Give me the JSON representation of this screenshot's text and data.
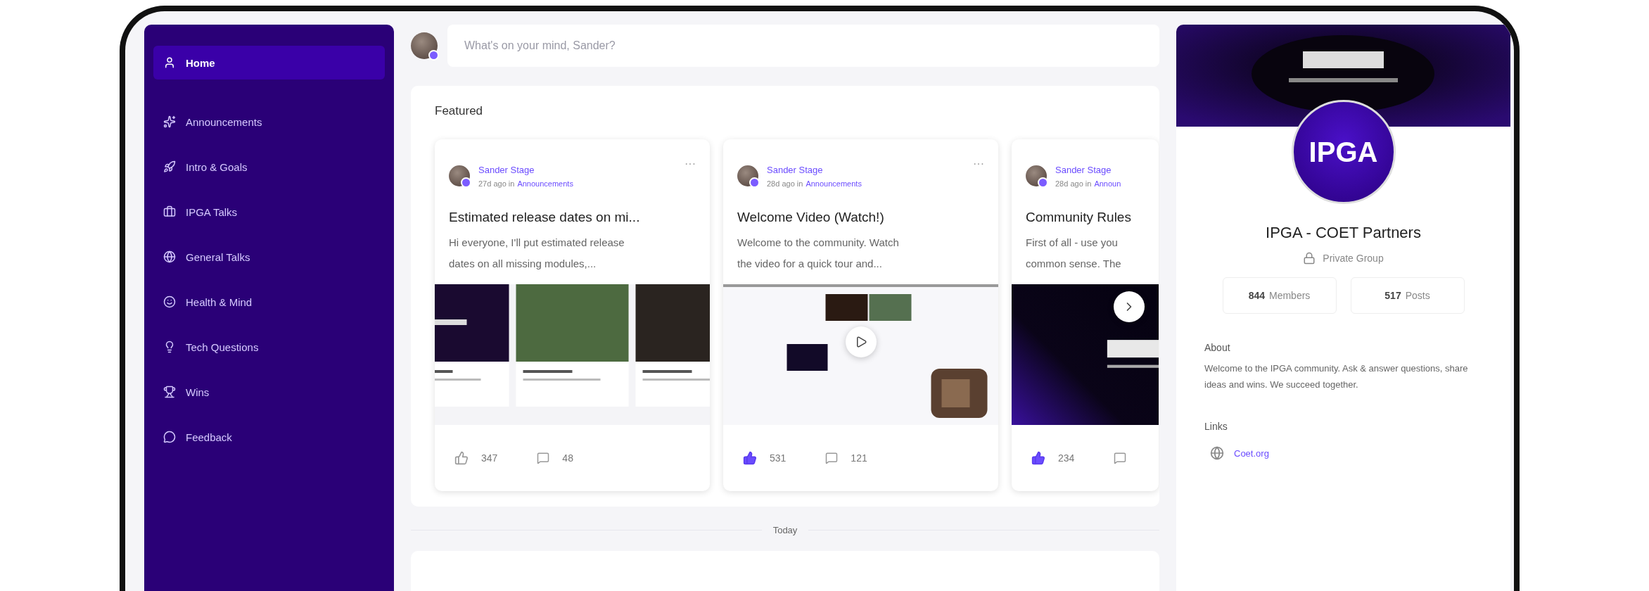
{
  "sidebar": {
    "items": [
      {
        "label": "Home",
        "selected": true
      },
      {
        "label": "Announcements",
        "selected": false
      },
      {
        "label": "Intro & Goals",
        "selected": false
      },
      {
        "label": "IPGA Talks",
        "selected": false
      },
      {
        "label": "General Talks",
        "selected": false
      },
      {
        "label": "Health & Mind",
        "selected": false
      },
      {
        "label": "Tech Questions",
        "selected": false
      },
      {
        "label": "Wins",
        "selected": false
      },
      {
        "label": "Feedback",
        "selected": false
      }
    ]
  },
  "composer": {
    "placeholder": "What's on your mind, Sander?"
  },
  "featured": {
    "title": "Featured",
    "posts": [
      {
        "author": "Sander Stage",
        "time": "27d ago in",
        "category": "Announcements",
        "menu": "···",
        "title": "Estimated release dates on mi...",
        "body_lines": [
          "Hi everyone, I'll put estimated release",
          "dates on all missing modules,..."
        ],
        "media": {
          "kind": "gallery"
        },
        "liked": false,
        "likes": "347",
        "comments": "48"
      },
      {
        "author": "Sander Stage",
        "time": "28d ago in",
        "category": "Announcements",
        "menu": "···",
        "title": "Welcome Video (Watch!)",
        "body_lines": [
          "Welcome to the community. Watch",
          "the video for a quick tour and..."
        ],
        "media": {
          "kind": "video-light"
        },
        "liked": true,
        "likes": "531",
        "comments": "121"
      },
      {
        "author": "Sander Stage",
        "time": "28d ago in",
        "category": "Announ",
        "title": "Community Rules",
        "body_lines": [
          "First of all - use you",
          "common sense. The"
        ],
        "media": {
          "kind": "video-dark"
        },
        "liked": true,
        "likes": "234"
      }
    ]
  },
  "divider": "Today",
  "group": {
    "logo": "IPGA",
    "name": "IPGA - COET Partners",
    "privacy": "Private Group",
    "stats": [
      {
        "value": "844",
        "label": "Members"
      },
      {
        "value": "517",
        "label": "Posts"
      }
    ],
    "about_title": "About",
    "about": "Welcome to the IPGA community. Ask & answer questions, share ideas and wins. We succeed together.",
    "links_title": "Links",
    "links": [
      "Coet.org"
    ]
  }
}
